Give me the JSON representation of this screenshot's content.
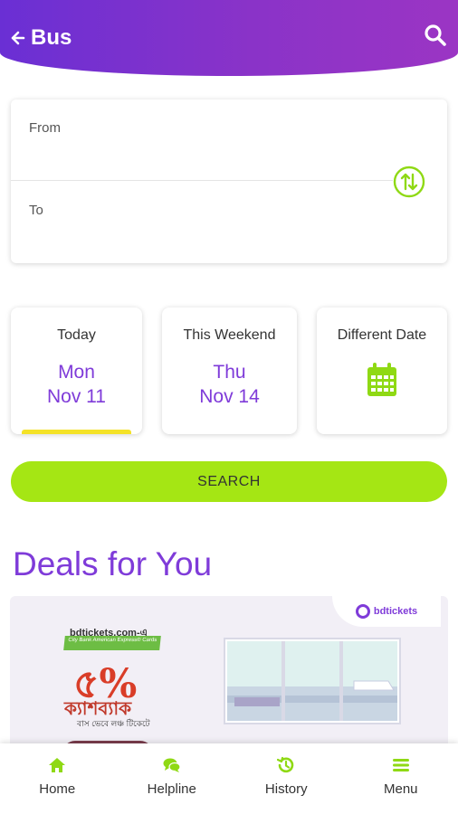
{
  "header": {
    "title": "Bus",
    "back_icon": "back-arrow-icon",
    "search_icon": "search-icon",
    "gradient": [
      "#6a2fd4",
      "#9b35c4"
    ]
  },
  "route": {
    "from_label": "From",
    "to_label": "To",
    "swap_icon": "swap-arrows-icon"
  },
  "dates": [
    {
      "heading": "Today",
      "weekday": "Mon",
      "date": "Nov 11",
      "selected": true
    },
    {
      "heading": "This Weekend",
      "weekday": "Thu",
      "date": "Nov 14",
      "selected": false
    },
    {
      "heading": "Different Date",
      "icon": "calendar-icon"
    }
  ],
  "search": {
    "label": "SEARCH"
  },
  "deals": {
    "title": "Deals for You",
    "banner": {
      "logo_text": "bdtickets",
      "site_text": "bdtickets.com-এ",
      "tag_text": "City Bank American Express® Cards",
      "percent_text": "৫%",
      "cashback_text": "ক্যাশব্যাক",
      "sub_text": "বাস ভেবে লঞ্চ টিকেটে"
    }
  },
  "nav": [
    {
      "label": "Home",
      "icon": "home-icon"
    },
    {
      "label": "Helpline",
      "icon": "chat-icon"
    },
    {
      "label": "History",
      "icon": "history-icon"
    },
    {
      "label": "Menu",
      "icon": "menu-icon"
    }
  ],
  "colors": {
    "accent_purple": "#7f3bd9",
    "accent_green": "#a5e614",
    "icon_green": "#8fd914",
    "indicator_yellow": "#f4e227"
  }
}
